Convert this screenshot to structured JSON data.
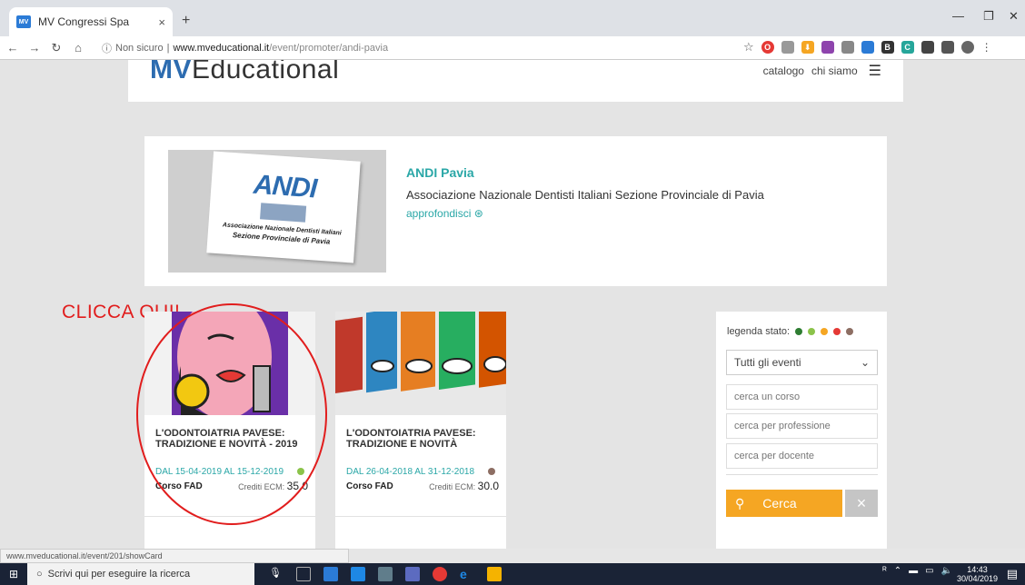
{
  "browser": {
    "tab_favicon": "MV",
    "tab_title": "MV Congressi Spa",
    "tab_close": "×",
    "new_tab": "+",
    "security_label": "Non sicuro",
    "url_host": "www.mveducational.it",
    "url_path": "/event/promoter/andi-pavia",
    "status_url": "www.mveducational.it/event/201/showCard"
  },
  "site": {
    "logo_bold": "MV",
    "logo_rest": "Educational",
    "nav": [
      "catalogo",
      "chi siamo"
    ]
  },
  "promoter": {
    "image_logo_a": "ANDI",
    "image_sub1": "Associazione Nazionale Dentisti Italiani",
    "image_sub2": "Sezione Provinciale di Pavia",
    "name": "ANDI Pavia",
    "description": "Associazione Nazionale Dentisti Italiani Sezione Provinciale di Pavia",
    "more_link": "approfondisci"
  },
  "annotation": "CLICCA QUI!",
  "events": [
    {
      "title": "L'ODONTOIATRIA PAVESE: TRADIZIONE E NOVITÀ - 2019",
      "dates": "DAL 15-04-2019 AL 15-12-2019",
      "status_color": "#8bc34a",
      "type": "Corso FAD",
      "credits_label": "Crediti ECM:",
      "credits_value": "35.0"
    },
    {
      "title": "L'ODONTOIATRIA PAVESE: TRADIZIONE E NOVITÀ",
      "dates": "DAL 26-04-2018 AL 31-12-2018",
      "status_color": "#8d6e63",
      "type": "Corso FAD",
      "credits_label": "Crediti ECM:",
      "credits_value": "30.0"
    }
  ],
  "filters": {
    "legend_label": "legenda stato:",
    "legend_colors": [
      "#2e7d32",
      "#8bc34a",
      "#f5a623",
      "#e53935",
      "#8d6e63"
    ],
    "select_value": "Tutti gli eventi",
    "search_course_placeholder": "cerca un corso",
    "search_profession_placeholder": "cerca per professione",
    "search_teacher_placeholder": "cerca per docente",
    "search_button": "Cerca",
    "clear_button": "×"
  },
  "taskbar": {
    "search_placeholder": "Scrivi qui per eseguire la ricerca",
    "time": "14:43",
    "date": "30/04/2019"
  }
}
